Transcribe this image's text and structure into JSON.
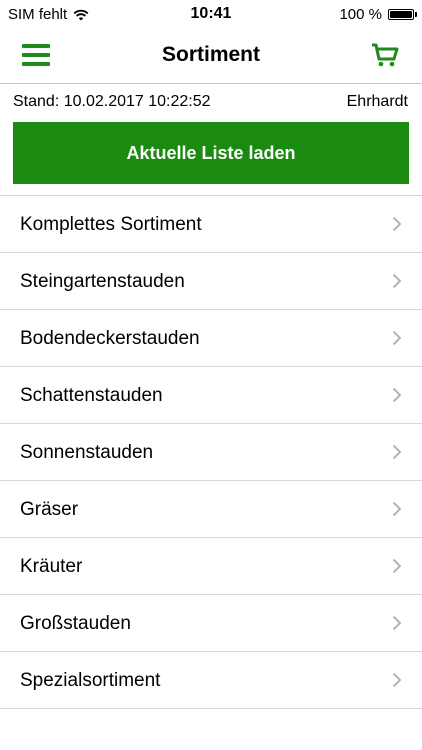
{
  "status_bar": {
    "carrier": "SIM fehlt",
    "time": "10:41",
    "battery": "100 %"
  },
  "nav": {
    "title": "Sortiment",
    "menu_icon": "hamburger-menu-icon",
    "cart_icon": "shopping-cart-icon",
    "accent_color": "#1a8a10"
  },
  "stand": {
    "label": "Stand: 10.02.2017 10:22:52",
    "user": "Ehrhardt"
  },
  "load_button": {
    "label": "Aktuelle Liste laden"
  },
  "list": {
    "items": [
      {
        "label": "Komplettes Sortiment"
      },
      {
        "label": "Steingartenstauden"
      },
      {
        "label": "Bodendeckerstauden"
      },
      {
        "label": "Schattenstauden"
      },
      {
        "label": "Sonnenstauden"
      },
      {
        "label": "Gräser"
      },
      {
        "label": "Kräuter"
      },
      {
        "label": "Großstauden"
      },
      {
        "label": "Spezialsortiment"
      }
    ]
  }
}
